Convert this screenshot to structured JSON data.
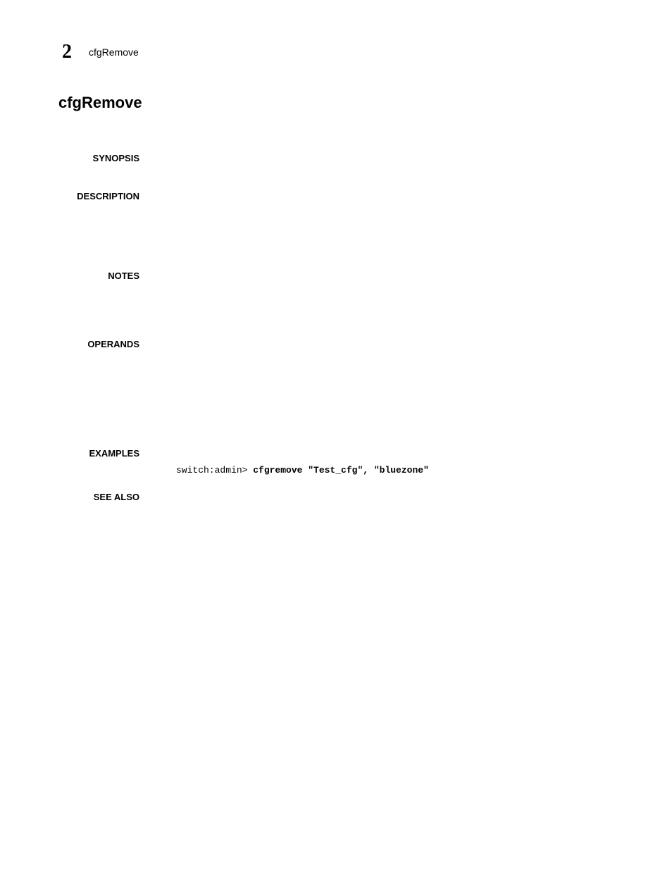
{
  "header": {
    "chapter_number": "2",
    "command_name": "cfgRemove"
  },
  "page_title": "cfgRemove",
  "sections": {
    "synopsis": {
      "label": "SYNOPSIS"
    },
    "description": {
      "label": "DESCRIPTION"
    },
    "notes": {
      "label": "NOTES"
    },
    "operands": {
      "label": "OPERANDS"
    },
    "examples": {
      "label": "EXAMPLES",
      "code_prompt": "switch:admin> ",
      "code_command": "cfgremove \"Test_cfg\", \"bluezone\""
    },
    "seealso": {
      "label": "SEE ALSO"
    }
  }
}
